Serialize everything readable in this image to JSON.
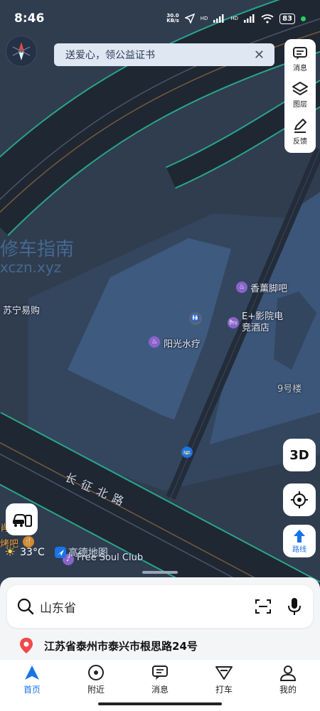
{
  "status_bar": {
    "time": "8:46",
    "net_speed_value": "30.0",
    "net_speed_unit": "KB/s",
    "signal_1": "HD",
    "signal_2": "HD",
    "battery": "83"
  },
  "banner": {
    "text": "送爱心，领公益证书",
    "close_icon": "close-icon"
  },
  "toolbar": {
    "message_label": "消息",
    "layers_label": "图层",
    "feedback_label": "反馈"
  },
  "map": {
    "watermark_line1": "修车指南",
    "watermark_line2": "xczn.xyz",
    "pois": {
      "suning": "苏宁易购",
      "xiangxun": "香薰脚吧",
      "eplus_line1": "E+影院电",
      "eplus_line2": "竞酒店",
      "yangguang": "阳光水疗",
      "building9": "9号楼",
      "freesoul": "Free Soul Club",
      "left_partial_1": "肖",
      "left_partial_2": "烤吧"
    },
    "road_name": "长征北路"
  },
  "buttons": {
    "three_d": "3D",
    "route_label": "路线"
  },
  "weather": {
    "temperature": "33°C",
    "brand": "高德地图"
  },
  "search": {
    "placeholder": "山东省"
  },
  "location": {
    "address": "江苏省泰州市泰兴市根思路24号"
  },
  "tabs": [
    {
      "label": "首页",
      "icon": "home-icon",
      "active": true
    },
    {
      "label": "附近",
      "icon": "nearby-icon",
      "active": false
    },
    {
      "label": "消息",
      "icon": "message-icon",
      "active": false
    },
    {
      "label": "打车",
      "icon": "taxi-icon",
      "active": false
    },
    {
      "label": "我的",
      "icon": "profile-icon",
      "active": false
    }
  ],
  "colors": {
    "map_background": "#2f3d4f",
    "road": "#1f2733",
    "road_edge": "#2aa58a",
    "block": "#3f5a7f",
    "accent": "#1a73e8",
    "poi_purple": "#8a63c9"
  }
}
